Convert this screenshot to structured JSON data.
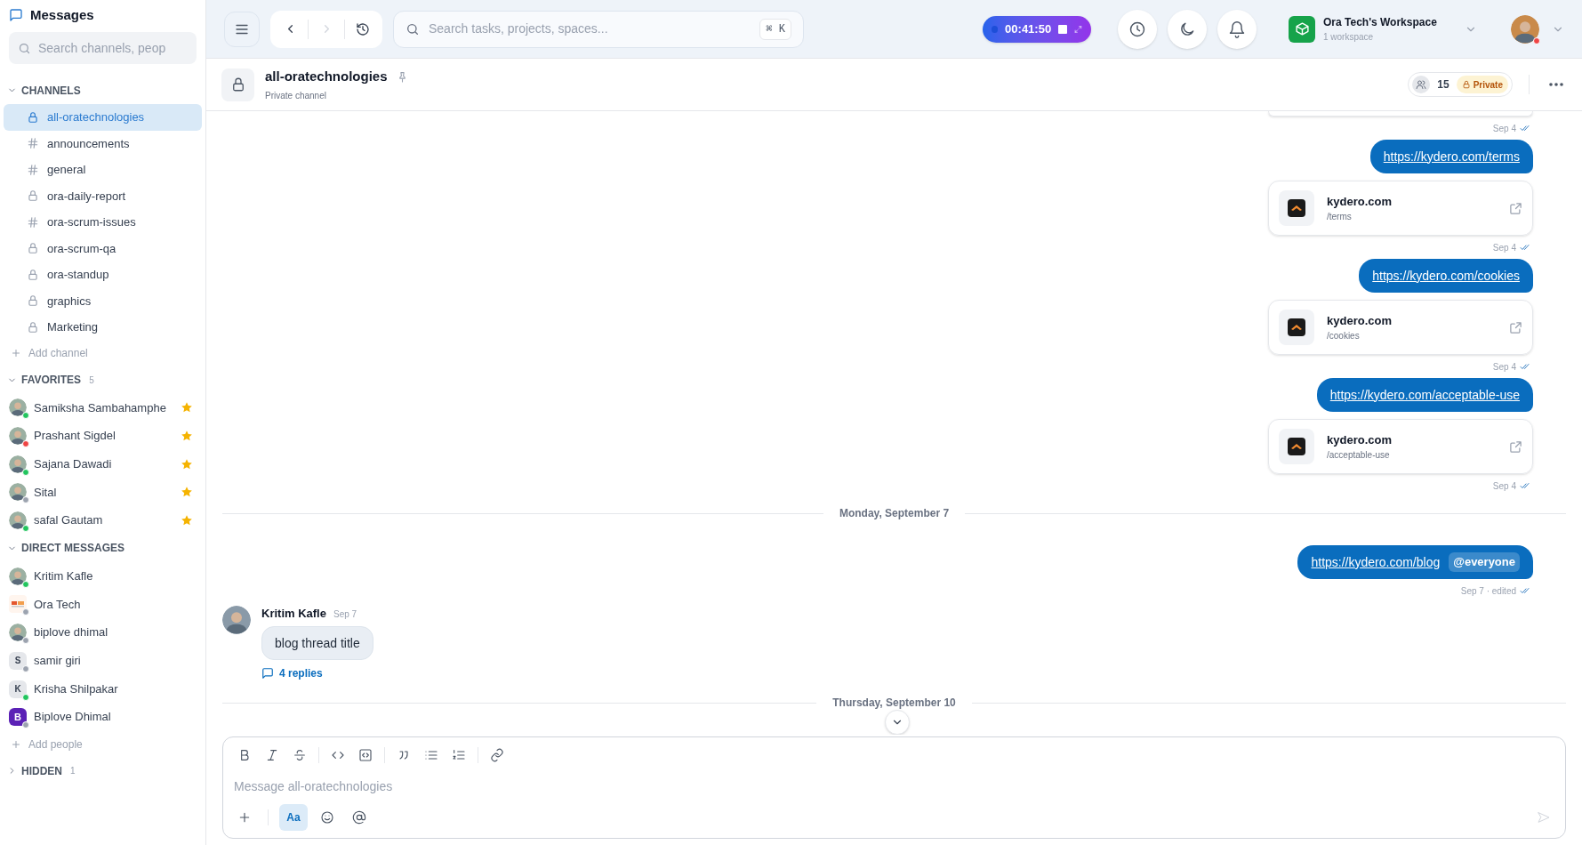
{
  "sidebar": {
    "title": "Messages",
    "search": {
      "placeholder": "Search channels, peop"
    },
    "sections": [
      {
        "kind": "channels",
        "title": "CHANNELS",
        "expanded": true,
        "add_label": "Add channel",
        "items": [
          {
            "name": "all-oratechnologies",
            "kind": "lock",
            "selected": true
          },
          {
            "name": "announcements",
            "kind": "hash",
            "selected": false
          },
          {
            "name": "general",
            "kind": "hash",
            "selected": false
          },
          {
            "name": "ora-daily-report",
            "kind": "lock",
            "selected": false
          },
          {
            "name": "ora-scrum-issues",
            "kind": "hash",
            "selected": false
          },
          {
            "name": "ora-scrum-qa",
            "kind": "lock",
            "selected": false
          },
          {
            "name": "ora-standup",
            "kind": "lock",
            "selected": false
          },
          {
            "name": "graphics",
            "kind": "lock",
            "selected": false
          },
          {
            "name": "Marketing",
            "kind": "lock",
            "selected": false
          }
        ]
      },
      {
        "kind": "people",
        "title": "FAVORITES",
        "count": "5",
        "expanded": true,
        "items": [
          {
            "name": "Samiksha Sambahamphe",
            "kind": "photo",
            "color": "#22c55e",
            "starred": true,
            "selected": false
          },
          {
            "name": "Prashant Sigdel",
            "kind": "photo",
            "color": "#ef4444",
            "starred": true,
            "selected": false
          },
          {
            "name": "Sajana Dawadi",
            "kind": "photo",
            "color": "#22c55e",
            "starred": true,
            "selected": false
          },
          {
            "name": "Sital",
            "kind": "photo",
            "color": "#9ca3af",
            "starred": true,
            "selected": false
          },
          {
            "name": "safal Gautam",
            "kind": "photo",
            "color": "#22c55e",
            "starred": true,
            "selected": false
          }
        ]
      },
      {
        "kind": "people",
        "title": "DIRECT MESSAGES",
        "expanded": true,
        "add_label": "Add people",
        "items": [
          {
            "name": "Kritim Kafle",
            "kind": "photo",
            "color": "#22c55e",
            "starred": false,
            "selected": false
          },
          {
            "name": "Ora Tech",
            "kind": "logo",
            "color": "#9ca3af",
            "starred": false,
            "selected": false
          },
          {
            "name": "biplove dhimal",
            "kind": "photo",
            "color": "#9ca3af",
            "starred": false,
            "selected": false
          },
          {
            "name": "samir giri",
            "kind": "initial",
            "initial": "S",
            "color": "#9ca3af",
            "starred": false,
            "selected": false
          },
          {
            "name": "Krisha Shilpakar",
            "kind": "initial",
            "initial": "K",
            "color": "#22c55e",
            "starred": false,
            "selected": false
          },
          {
            "name": "Biplove Dhimal",
            "kind": "monogram",
            "initial": "B",
            "color": "#9ca3af",
            "starred": false,
            "selected": false
          }
        ]
      },
      {
        "title": "HIDDEN",
        "count": "1",
        "expanded": false
      }
    ]
  },
  "topbar": {
    "search": {
      "placeholder": "Search tasks, projects, spaces...",
      "shortcut": "⌘ K"
    },
    "timer": {
      "time": "00:41:50",
      "running": true
    },
    "workspace": {
      "name": "Ora Tech's Workspace",
      "subtitle": "1 workspace"
    },
    "user": {
      "color": "#ef4444"
    }
  },
  "channel": {
    "name": "all-oratechnologies",
    "subtitle": "Private channel",
    "members": "15",
    "privacy": "Private"
  },
  "messages": [
    {
      "kind": "preview_stub"
    },
    {
      "kind": "meta",
      "time": "Sep 4"
    },
    {
      "kind": "outgoing",
      "link": "https://kydero.com/terms"
    },
    {
      "kind": "preview",
      "domain": "kydero.com",
      "path": "/terms"
    },
    {
      "kind": "meta",
      "time": "Sep 4"
    },
    {
      "kind": "outgoing",
      "link": "https://kydero.com/cookies"
    },
    {
      "kind": "preview",
      "domain": "kydero.com",
      "path": "/cookies"
    },
    {
      "kind": "meta",
      "time": "Sep 4"
    },
    {
      "kind": "outgoing",
      "link": "https://kydero.com/acceptable-use"
    },
    {
      "kind": "preview",
      "domain": "kydero.com",
      "path": "/acceptable-use"
    },
    {
      "kind": "meta",
      "time": "Sep 4"
    },
    {
      "kind": "divider",
      "label": "Monday, September 7"
    },
    {
      "kind": "outgoing",
      "link": "https://kydero.com/blog",
      "mention": "@everyone"
    },
    {
      "kind": "meta",
      "time": "Sep 7 · edited"
    },
    {
      "kind": "incoming",
      "author": "Kritim Kafle",
      "time": "Sep 7",
      "text": "blog thread title",
      "replies": "4 replies"
    },
    {
      "kind": "divider",
      "label": "Thursday, September 10"
    }
  ],
  "composer": {
    "placeholder": "Message all-oratechnologies",
    "format_label": "Aa",
    "text_format": true
  }
}
